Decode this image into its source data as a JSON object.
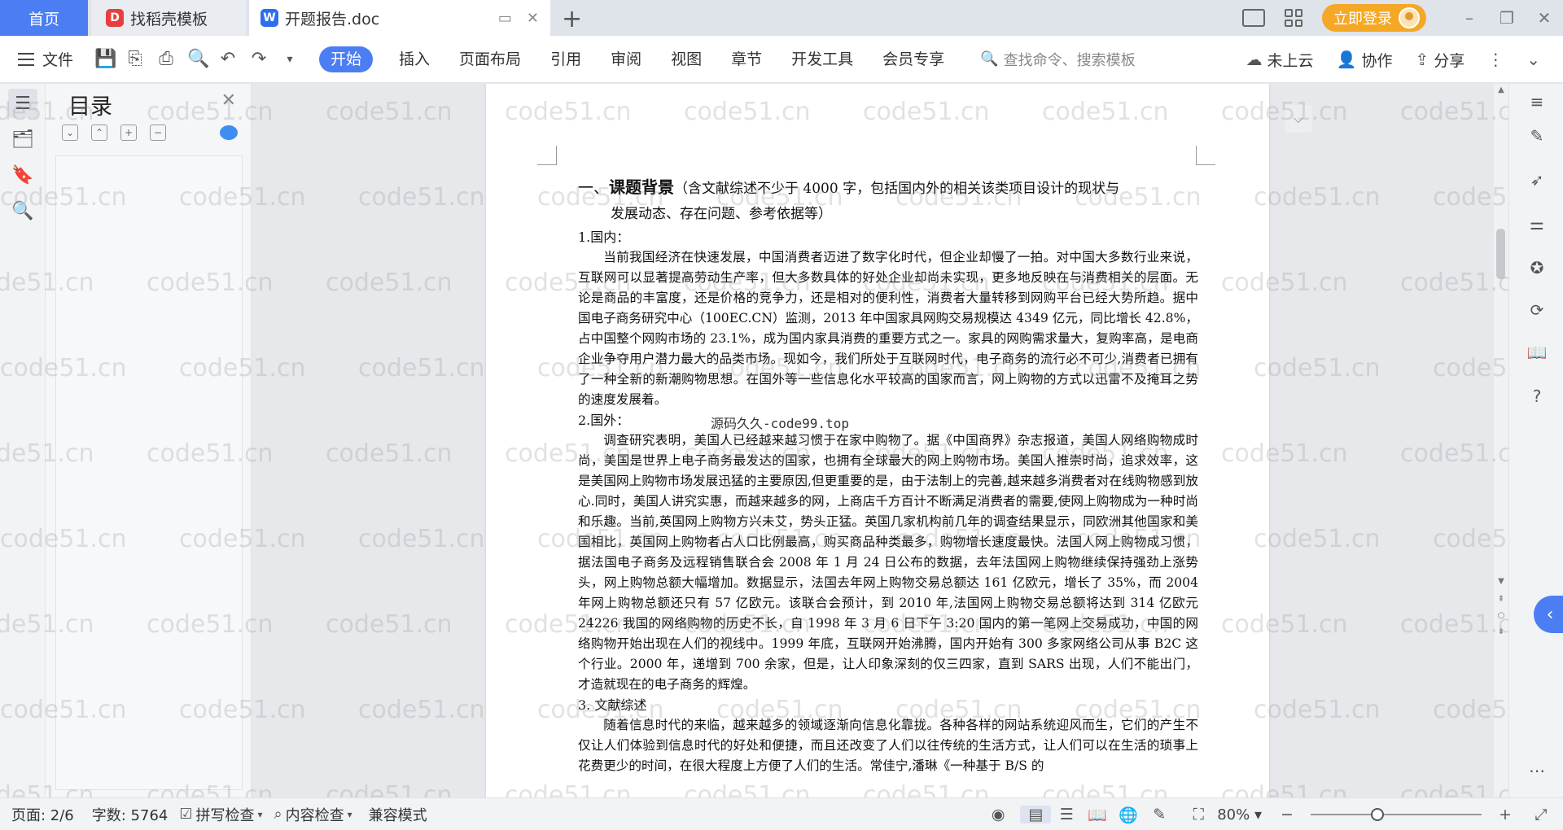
{
  "tabs": {
    "home": "首页",
    "templates": "找稻壳模板",
    "document": "开题报告.doc",
    "add": "+"
  },
  "titlebar": {
    "login": "立即登录",
    "min": "–",
    "restore": "❐",
    "close": "✕"
  },
  "ribbon": {
    "file": "文件",
    "tabs": [
      "开始",
      "插入",
      "页面布局",
      "引用",
      "审阅",
      "视图",
      "章节",
      "开发工具",
      "会员专享"
    ],
    "search_placeholder": "查找命令、搜索模板",
    "cloud": "未上云",
    "collab": "协作",
    "share": "分享"
  },
  "toc": {
    "title": "目录"
  },
  "document": {
    "heading_prefix": "一、",
    "heading_title": "课题背景",
    "heading_note_1": "（含文献综述不少于 4000 字，包括国内外的相关该类项目设计的现状与",
    "heading_note_2": "发展动态、存在问题、参考依据等）",
    "sec1": "1.国内：",
    "p1": "当前我国经济在快速发展，中国消费者迈进了数字化时代，但企业却慢了一拍。对中国大多数行业来说，互联网可以显著提高劳动生产率，但大多数具体的好处企业却尚未实现，更多地反映在与消费相关的层面。无论是商品的丰富度，还是价格的竞争力，还是相对的便利性，消费者大量转移到网购平台已经大势所趋。据中国电子商务研究中心（100EC.CN）监测，2013 年中国家具网购交易规模达 4349 亿元，同比增长 42.8%，占中国整个网购市场的 23.1%，成为国内家具消费的重要方式之一。家具的网购需求量大，复购率高，是电商企业争夺用户潜力最大的品类市场。现如今，我们所处于互联网时代，电子商务的流行必不可少,消费者已拥有了一种全新的新潮购物思想。在国外等一些信息化水平较高的国家而言，网上购物的方式以迅雷不及掩耳之势的速度发展着。",
    "sec2": "2.国外：",
    "watermark_center": "源码久久-code99.top",
    "p2": "调查研究表明，美国人已经越来越习惯于在家中购物了。据《中国商界》杂志报道，美国人网络购物成时尚，美国是世界上电子商务最发达的国家，也拥有全球最大的网上购物市场。美国人推崇时尚，追求效率，这是美国网上购物市场发展迅猛的主要原因,但更重要的是，由于法制上的完善,越来越多消费者对在线购物感到放心.同时，美国人讲究实惠，而越来越多的网，上商店千方百计不断满足消费者的需要,使网上购物成为一种时尚和乐趣。当前,英国网上购物方兴未艾，势头正猛。英国几家机构前几年的调查结果显示，同欧洲其他国家和美国相比，英国网上购物者占人口比例最高，购买商品种类最多，购物增长速度最快。法国人网上购物成习惯，据法国电子商务及远程销售联合会 2008 年 1 月 24 日公布的数据，去年法国网上购物继续保持强劲上涨势头，网上购物总额大幅增加。数据显示，法国去年网上购物交易总额达 161 亿欧元，增长了 35%，而 2004 年网上购物总额还只有 57 亿欧元。该联合会预计，到 2010 年,法国网上购物交易总额将达到 314 亿欧元 24226 我国的网络购物的历史不长，自 1998 年 3 月 6 日下午 3:20 国内的第一笔网上交易成功，中国的网络购物开始出现在人们的视线中。1999 年底，互联网开始沸腾，国内开始有 300 多家网络公司从事 B2C 这个行业。2000 年，递增到 700 余家，但是，让人印象深刻的仅三四家，直到 SARS 出现，人们不能出门，才造就现在的电子商务的辉煌。",
    "sec3": "3. 文献综述",
    "p3": "随着信息时代的来临，越来越多的领域逐渐向信息化靠拢。各种各样的网站系统迎风而生，它们的产生不仅让人们体验到信息时代的好处和便捷，而且还改变了人们以往传统的生活方式，让人们可以在生活的琐事上花费更少的时间，在很大程度上方便了人们的生活。常佳宁,潘琳《一种基于 B/S 的"
  },
  "watermark": "code51.cn",
  "status": {
    "page": "页面: 2/6",
    "words": "字数: 5764",
    "spell": "拼写检查",
    "content": "内容检查",
    "compat": "兼容模式",
    "zoom": "80%",
    "zoom_fraction": 0.38
  }
}
